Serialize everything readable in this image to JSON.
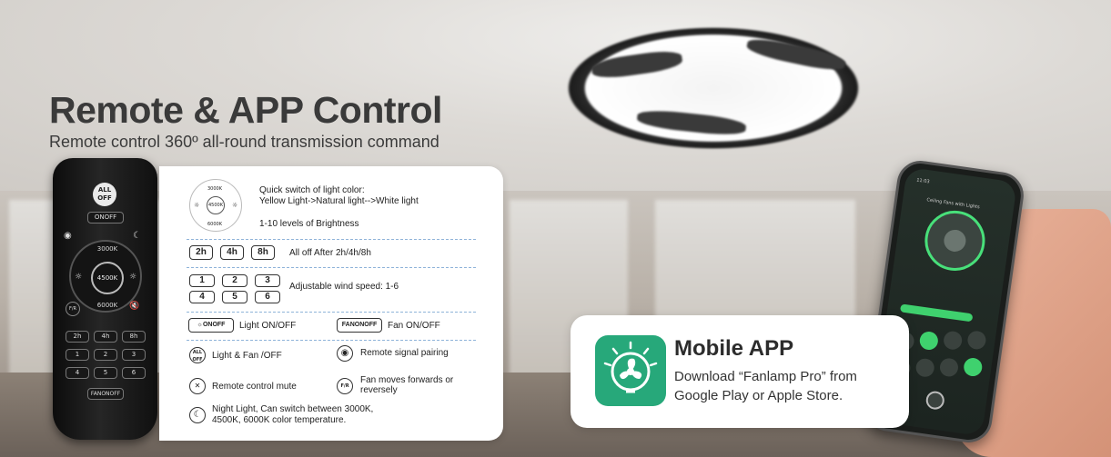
{
  "headline": "Remote & APP Control",
  "subline": "Remote control 360º all-round transmission command",
  "remote": {
    "all_off": "ALL OFF",
    "light_onoff": "ONOFF",
    "k3000": "3000K",
    "k4500": "4500K",
    "k6000": "6000K",
    "fr": "F/R",
    "timers": [
      "2h",
      "4h",
      "8h"
    ],
    "speeds": [
      "1",
      "2",
      "3",
      "4",
      "5",
      "6"
    ],
    "fan_onoff": "FANONOFF"
  },
  "card": {
    "dial_labels": {
      "top": "3000K",
      "center": "4500K",
      "bottom": "6000K"
    },
    "quick_switch_1": "Quick switch of light color:",
    "quick_switch_2": "Yellow Light->Natural light-->White light",
    "brightness": "1-10 levels of Brightness",
    "timer_keys": [
      "2h",
      "4h",
      "8h"
    ],
    "timer_text": "All off After 2h/4h/8h",
    "speed_keys": [
      "1",
      "2",
      "3",
      "4",
      "5",
      "6"
    ],
    "speed_text": "Adjustable wind speed: 1-6",
    "light_key": "ONOFF",
    "light_text": "Light ON/OFF",
    "fan_key": "FANONOFF",
    "fan_text": "Fan ON/OFF",
    "allfan_icon": "ALL OFF",
    "allfan_text": "Light & Fan /OFF",
    "pairing_text": "Remote signal pairing",
    "mute_text": "Remote control mute",
    "fr_icon": "F/R",
    "fr_text_1": "Fan moves forwards or",
    "fr_text_2": "reversely",
    "night_text_1": "Night Light, Can switch between 3000K,",
    "night_text_2": "4500K, 6000K color temperature."
  },
  "app": {
    "title": "Mobile APP",
    "line1": "Download “Fanlamp Pro” from",
    "line2": "Google Play or Apple Store."
  },
  "phone": {
    "time": "11:03",
    "screen_title": "Ceiling Fans with Lights"
  },
  "colors": {
    "accent_green": "#27a87a",
    "phone_green": "#3fd16e",
    "dash_blue": "#8fb3d9"
  }
}
